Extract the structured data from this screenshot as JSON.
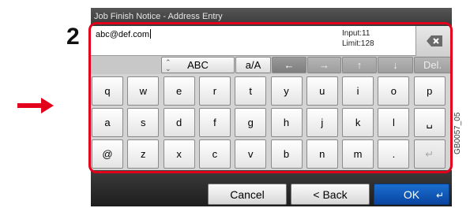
{
  "window": {
    "title": "Job Finish Notice - Address Entry"
  },
  "callout": {
    "step_number": "2",
    "arrow_color": "#e3001b",
    "highlight_color": "#e3001b"
  },
  "input": {
    "value": "abc@def.com",
    "input_count": "Input:11",
    "limit": "Limit:128",
    "backspace_icon": "backspace-icon"
  },
  "toolbar": {
    "mode_label": "ABC",
    "case_label": "a/A",
    "left_arrow": "←",
    "right_arrow": "→",
    "up_arrow": "↑",
    "down_arrow": "↓",
    "delete_label": "Del."
  },
  "keyboard": {
    "row1": [
      "q",
      "w",
      "e",
      "r",
      "t",
      "y",
      "u",
      "i",
      "o",
      "p"
    ],
    "row2": [
      "a",
      "s",
      "d",
      "f",
      "g",
      "h",
      "j",
      "k",
      "l",
      "␣"
    ],
    "row3": [
      "@",
      "z",
      "x",
      "c",
      "v",
      "b",
      "n",
      "m",
      ".",
      "↵"
    ]
  },
  "bottom": {
    "cancel_label": "Cancel",
    "back_label": "< Back",
    "ok_label": "OK",
    "ok_icon": "↵"
  },
  "figure_code": "GB0057_05"
}
